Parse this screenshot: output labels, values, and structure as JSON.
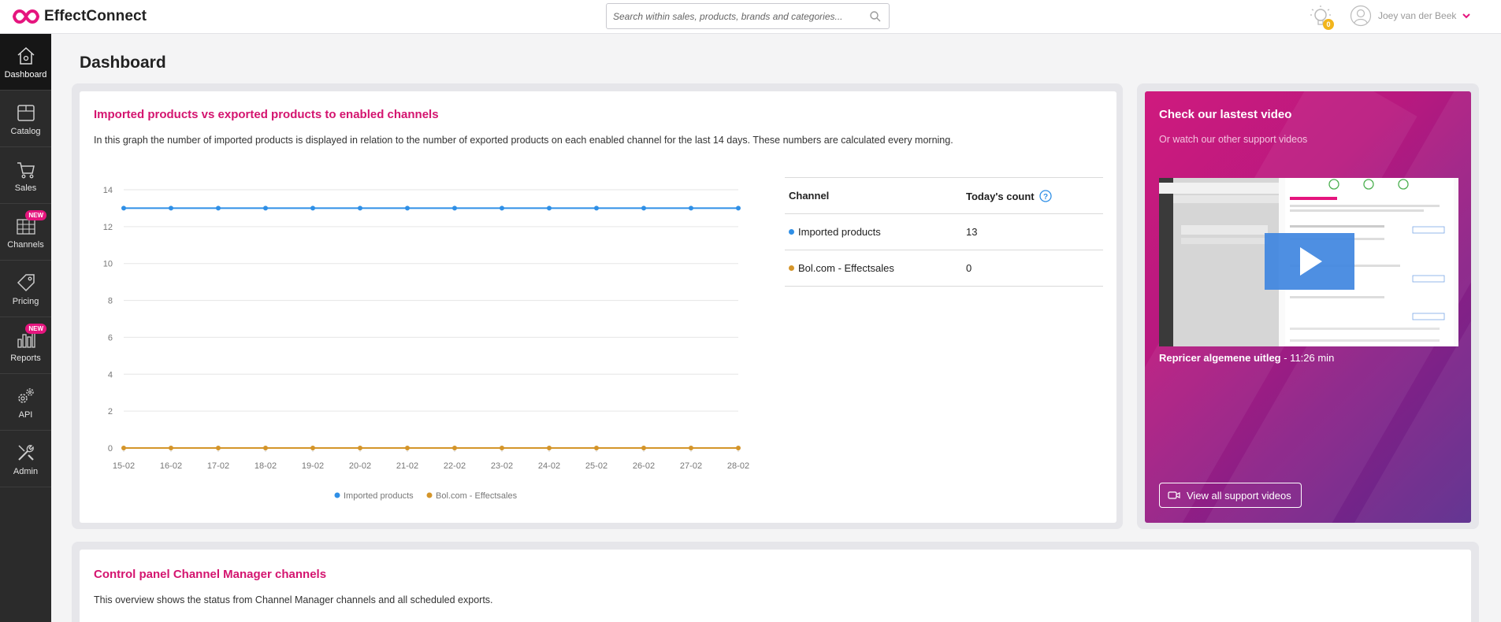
{
  "app": {
    "name": "EffectConnect"
  },
  "search": {
    "placeholder": "Search within sales, products, brands and categories..."
  },
  "notifications": {
    "count": "0"
  },
  "user": {
    "name": "Joey van der Beek"
  },
  "sidebar": {
    "items": [
      {
        "label": "Dashboard",
        "icon": "house-icon",
        "active": true
      },
      {
        "label": "Catalog",
        "icon": "box-icon"
      },
      {
        "label": "Sales",
        "icon": "cart-icon"
      },
      {
        "label": "Channels",
        "icon": "channels-icon",
        "badge": "NEW"
      },
      {
        "label": "Pricing",
        "icon": "price-tag-icon"
      },
      {
        "label": "Reports",
        "icon": "bar-chart-icon",
        "badge": "NEW"
      },
      {
        "label": "API",
        "icon": "gears-icon"
      },
      {
        "label": "Admin",
        "icon": "tools-icon"
      }
    ]
  },
  "page": {
    "title": "Dashboard"
  },
  "products_card": {
    "title": "Imported products vs exported products to enabled channels",
    "description": "In this graph the number of imported products is displayed in relation to the number of exported products on each enabled channel for the last 14 days. These numbers are calculated every morning."
  },
  "chart_data": {
    "type": "line",
    "x": [
      "15-02",
      "16-02",
      "17-02",
      "18-02",
      "19-02",
      "20-02",
      "21-02",
      "22-02",
      "23-02",
      "24-02",
      "25-02",
      "26-02",
      "27-02",
      "28-02"
    ],
    "series": [
      {
        "name": "Imported products",
        "color": "#2f8fe6",
        "values": [
          13,
          13,
          13,
          13,
          13,
          13,
          13,
          13,
          13,
          13,
          13,
          13,
          13,
          13
        ]
      },
      {
        "name": "Bol.com - Effectsales",
        "color": "#d4952a",
        "values": [
          0,
          0,
          0,
          0,
          0,
          0,
          0,
          0,
          0,
          0,
          0,
          0,
          0,
          0
        ]
      }
    ],
    "ylim": [
      0,
      14
    ],
    "yticks": [
      0,
      2,
      4,
      6,
      8,
      10,
      12,
      14
    ],
    "grid": true,
    "legend": "bottom"
  },
  "channel_table": {
    "headers": {
      "channel": "Channel",
      "count": "Today's count"
    },
    "rows": [
      {
        "channel": "Imported products",
        "count": "13",
        "color": "#2f8fe6"
      },
      {
        "channel": "Bol.com - Effectsales",
        "count": "0",
        "color": "#d4952a"
      }
    ]
  },
  "video_card": {
    "title": "Check our lastest video",
    "subtitle": "Or watch our other support videos",
    "video_title": "Repricer algemene uitleg",
    "video_duration": " - 11:26 min",
    "button_label": "View all support videos"
  },
  "control_card": {
    "title": "Control panel Channel Manager channels",
    "description": "This overview shows the status from Channel Manager channels and all scheduled exports."
  },
  "colors": {
    "accent": "#d4146f",
    "sidebar": "#2b2b2b"
  }
}
